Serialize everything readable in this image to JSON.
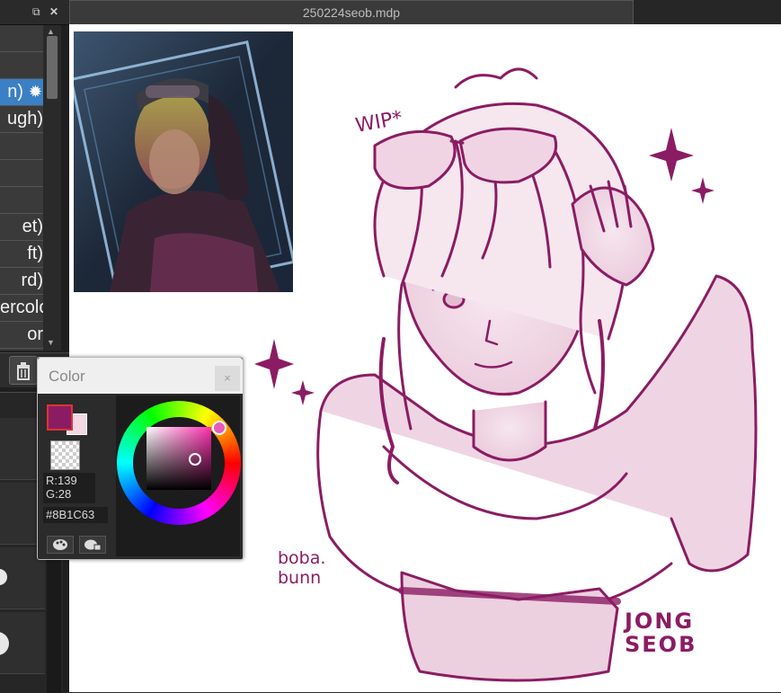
{
  "brush_panel": {
    "brushes": [
      {
        "label": "",
        "selected": false
      },
      {
        "label": "n)",
        "selected": true
      },
      {
        "label": "ugh)",
        "selected": false
      },
      {
        "label": "",
        "selected": false
      },
      {
        "label": "",
        "selected": false
      },
      {
        "label": "et)",
        "selected": false
      },
      {
        "label": "ft)",
        "selected": false
      },
      {
        "label": "rd)",
        "selected": false
      },
      {
        "label": "ercolo",
        "selected": false
      },
      {
        "label": "or",
        "selected": false
      }
    ],
    "gear_icon": "gear-icon",
    "trash_icon": "trash-icon"
  },
  "document": {
    "tab_title": "250224seob.mdp"
  },
  "color_window": {
    "title": "Color",
    "close_label": "×",
    "main_color": "#8B1C63",
    "sub_color": "#F3D8E3",
    "r_text": "R:139",
    "g_text": "G:28",
    "hex_text": "#8B1C63",
    "palette_icon": "palette-icon",
    "picker_icon": "palette-picker-icon"
  },
  "artwork": {
    "wip_text": "WIP*",
    "signature_line1": "boba.",
    "signature_line2": "bunn",
    "name_line1": "JONG",
    "name_line2": "SEOB",
    "ink_color": "#8B1C63"
  }
}
